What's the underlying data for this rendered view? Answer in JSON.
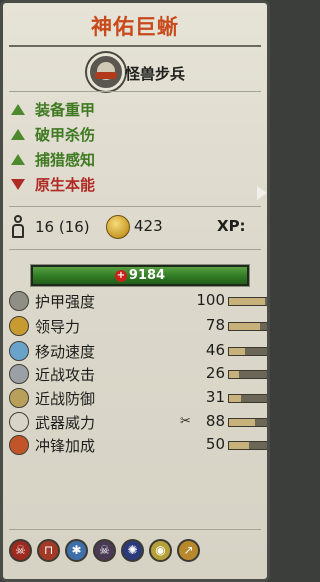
{
  "unit_name": "神佑巨蜥",
  "unit_type": "怪兽步兵",
  "attributes": [
    {
      "label": "装备重甲",
      "kind": "positive",
      "color": "#3f7a22"
    },
    {
      "label": "破甲杀伤",
      "kind": "positive",
      "color": "#3f7a22"
    },
    {
      "label": "捕猎感知",
      "kind": "positive",
      "color": "#3f7a22"
    },
    {
      "label": "原生本能",
      "kind": "negative",
      "color": "#b02a25"
    }
  ],
  "unit_count": "16 (16)",
  "upkeep": "423",
  "xp_label": "XP:",
  "health": "9184",
  "stats": [
    {
      "label": "护甲强度",
      "value": "100",
      "level": 0.9,
      "icon": "shield-icon"
    },
    {
      "label": "领导力",
      "value": "78",
      "level": 0.78,
      "icon": "horn-icon"
    },
    {
      "label": "移动速度",
      "value": "46",
      "level": 0.4,
      "icon": "boot-icon"
    },
    {
      "label": "近战攻击",
      "value": "26",
      "level": 0.25,
      "icon": "sword-icon"
    },
    {
      "label": "近战防御",
      "value": "31",
      "level": 0.3,
      "icon": "defense-shield-icon"
    },
    {
      "label": "武器威力",
      "value": "88",
      "level": 0.65,
      "icon": "weapon-strength-icon"
    },
    {
      "label": "冲锋加成",
      "value": "50",
      "level": 0.5,
      "icon": "charge-icon"
    }
  ],
  "abilities": [
    {
      "icon": "fear-icon",
      "color": "#9c2a20"
    },
    {
      "icon": "gate-icon",
      "color": "#a33a28"
    },
    {
      "icon": "frost-icon",
      "color": "#3f6fa8"
    },
    {
      "icon": "skull-icon",
      "color": "#4a3b55"
    },
    {
      "icon": "vortex-icon",
      "color": "#2b3a7a"
    },
    {
      "icon": "eye-icon",
      "color": "#b5a13a"
    },
    {
      "icon": "spear-icon",
      "color": "#b7892c"
    }
  ]
}
